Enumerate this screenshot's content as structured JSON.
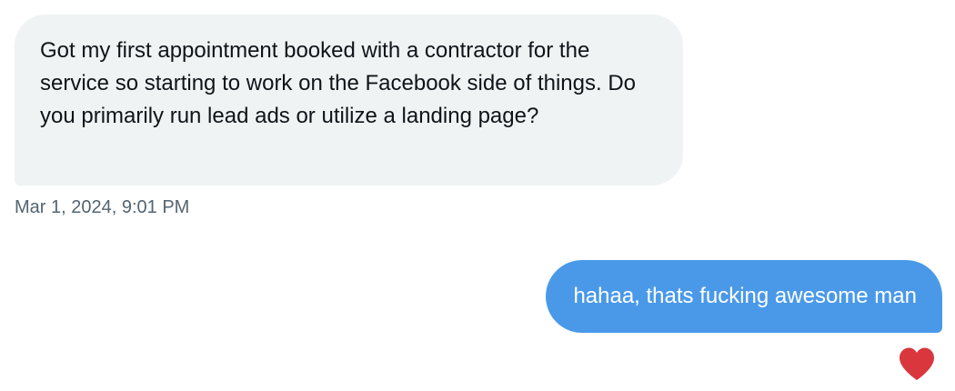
{
  "conversation": {
    "received_message": {
      "text": "Got my first appointment booked with a contractor for the service so starting to work on the Facebook side of things. Do you primarily run lead ads or utilize a landing page?",
      "timestamp": "Mar 1, 2024, 9:01 PM"
    },
    "sent_message": {
      "text": "hahaa, thats fucking awesome man",
      "reaction_icon": "heart-icon"
    }
  },
  "colors": {
    "received_bubble": "#eff3f4",
    "sent_bubble": "#4a99e9",
    "timestamp_text": "#536471",
    "reaction_heart": "#d9363e"
  }
}
